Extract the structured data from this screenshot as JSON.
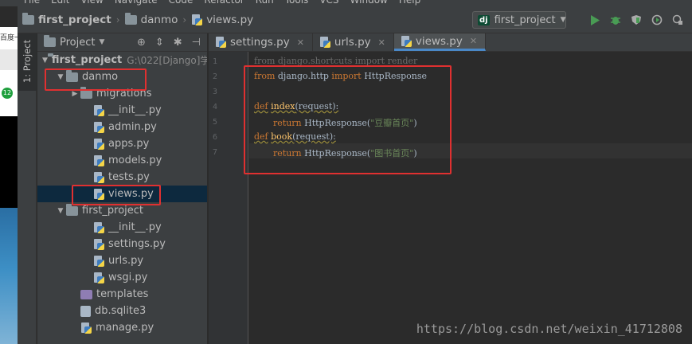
{
  "menu": [
    "File",
    "Edit",
    "View",
    "Navigate",
    "Code",
    "Refactor",
    "Run",
    "Tools",
    "VCS",
    "Window",
    "Help"
  ],
  "breadcrumb": [
    "first_project",
    "danmo",
    "views.py"
  ],
  "run_config": {
    "badge": "dj",
    "label": "first_project",
    "arrow": "▼"
  },
  "toolbar_icons": [
    "run-icon",
    "debug-icon",
    "coverage-icon",
    "profile-icon",
    "stop-icon"
  ],
  "external_window": {
    "text": "百度一",
    "badge": "12"
  },
  "side_tab": "1: Project",
  "project_panel": {
    "title": "Project",
    "arrow": "▼",
    "tree": [
      {
        "label": "first_project",
        "suffix": "G:\\022[Django]学",
        "type": "root",
        "depth": 0,
        "expanded": true
      },
      {
        "label": "danmo",
        "type": "folder",
        "depth": 1,
        "expanded": true
      },
      {
        "label": "migrations",
        "type": "folder",
        "depth": 2,
        "expanded": false
      },
      {
        "label": "__init__.py",
        "type": "py",
        "depth": 3
      },
      {
        "label": "admin.py",
        "type": "py",
        "depth": 3
      },
      {
        "label": "apps.py",
        "type": "py",
        "depth": 3
      },
      {
        "label": "models.py",
        "type": "py",
        "depth": 3
      },
      {
        "label": "tests.py",
        "type": "py",
        "depth": 3
      },
      {
        "label": "views.py",
        "type": "py",
        "depth": 3,
        "selected": true
      },
      {
        "label": "first_project",
        "type": "folder",
        "depth": 1,
        "expanded": true
      },
      {
        "label": "__init__.py",
        "type": "py",
        "depth": 3
      },
      {
        "label": "settings.py",
        "type": "py",
        "depth": 3
      },
      {
        "label": "urls.py",
        "type": "py",
        "depth": 3
      },
      {
        "label": "wsgi.py",
        "type": "py",
        "depth": 3
      },
      {
        "label": "templates",
        "type": "template-folder",
        "depth": 2
      },
      {
        "label": "db.sqlite3",
        "type": "db",
        "depth": 2
      },
      {
        "label": "manage.py",
        "type": "py",
        "depth": 2
      }
    ]
  },
  "tabs": [
    {
      "label": "settings.py",
      "active": false
    },
    {
      "label": "urls.py",
      "active": false
    },
    {
      "label": "views.py",
      "active": true
    }
  ],
  "code": {
    "line_numbers": [
      "1",
      "2",
      "3",
      "4",
      "5",
      "6",
      "7"
    ],
    "line1": {
      "kw1": "from",
      "mod": " django.shortcuts ",
      "kw2": "import",
      "name": " render"
    },
    "line2": {
      "kw1": "from",
      "mod": " django.http ",
      "kw2": "import",
      "name": " HttpResponse"
    },
    "line4": {
      "kw": "def",
      "fn": "index",
      "rest": "(request):"
    },
    "line5": {
      "kw": "return",
      "call": " HttpResponse(",
      "str": "\"豆瓣首页\"",
      "end": ")"
    },
    "line6": {
      "kw": "def",
      "fn": "book",
      "rest": "(request):"
    },
    "line7": {
      "kw": "return",
      "call": " HttpResponse(",
      "str": "\"图书首页\"",
      "end": ")"
    }
  },
  "colors": {
    "annotation": "#e03030",
    "keyword": "#cc7832",
    "function": "#ffc66d",
    "string": "#6a8759",
    "selection": "#0d293e"
  },
  "watermark": "https://blog.csdn.net/weixin_41712808"
}
